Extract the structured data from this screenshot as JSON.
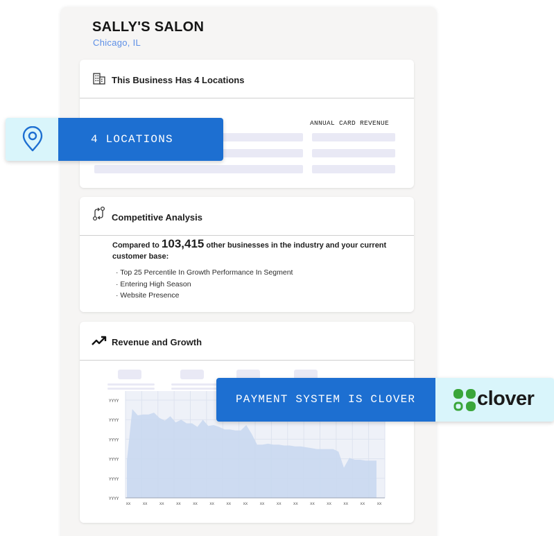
{
  "business": {
    "name": "SALLY'S SALON",
    "city": "Chicago, IL"
  },
  "locations_card": {
    "title": "This Business Has 4 Locations",
    "column_header": "ANNUAL CARD REVENUE",
    "icon": "building-icon"
  },
  "competitive_card": {
    "title": "Competitive Analysis",
    "icon": "arrows-exchange-icon",
    "intro_before": "Compared to ",
    "intro_number": "103,415",
    "intro_after": " other businesses in the industry and your current customer base:",
    "bullets": [
      "Top 25 Percentile In Growth Performance In Segment",
      "Entering High Season",
      "Website Presence"
    ]
  },
  "revenue_card": {
    "title": "Revenue and Growth",
    "icon": "trending-up-icon"
  },
  "chart_data": {
    "type": "area",
    "y_tick_labels": [
      "YYYY",
      "YYYY",
      "YYYY",
      "YYYY",
      "YYYY",
      "YYYY"
    ],
    "x_tick_labels": [
      "XX",
      "XX",
      "XX",
      "XX",
      "XX",
      "XX",
      "XX",
      "XX",
      "XX",
      "XX",
      "XX",
      "XX",
      "XX",
      "XX",
      "XX",
      "XX"
    ],
    "values": [
      42,
      100,
      93,
      94,
      94,
      96,
      90,
      87,
      92,
      85,
      88,
      84,
      84,
      80,
      88,
      81,
      82,
      80,
      77,
      77,
      76,
      76,
      82,
      72,
      60,
      60,
      61,
      60,
      60,
      59,
      59,
      58,
      58,
      57,
      56,
      55,
      55,
      55,
      55,
      52,
      34,
      45,
      43,
      43,
      42,
      42,
      42
    ],
    "grid": true,
    "fill_color": "#c9d8ef"
  },
  "callouts": {
    "locations": {
      "text": "4 LOCATIONS",
      "icon": "map-pin-icon"
    },
    "payment": {
      "text": "PAYMENT SYSTEM IS CLOVER",
      "logo_text": "clover",
      "logo_icon": "clover-leaf-icon"
    }
  },
  "colors": {
    "accent_blue": "#1d6fd1",
    "callout_bg": "#d9f5fb",
    "city_blue": "#5d8fe6",
    "skeleton": "#e9e9f5"
  }
}
